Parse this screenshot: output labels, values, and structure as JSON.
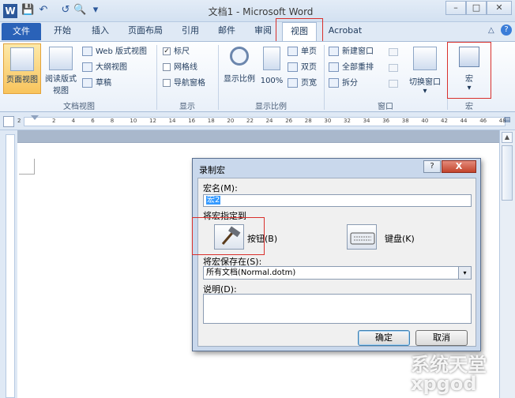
{
  "window": {
    "title": "文档1 - Microsoft Word",
    "minimize": "–",
    "restore": "□",
    "close": "✕"
  },
  "quick_access": {
    "save": "💾",
    "undo": "↶",
    "redo": "↺",
    "print_preview": "🔍",
    "customize": "▾"
  },
  "tabs": [
    "文件",
    "开始",
    "插入",
    "页面布局",
    "引用",
    "邮件",
    "审阅",
    "视图",
    "Acrobat"
  ],
  "active_tab": "视图",
  "ribbon": {
    "doc_views": {
      "print_layout": "页面视图",
      "reading_1": "阅读版式",
      "reading_2": "视图",
      "web": "Web 版式视图",
      "outline": "大纲视图",
      "draft": "草稿",
      "group": "文档视图"
    },
    "show": {
      "ruler": "标尺",
      "ruler_checked": "✓",
      "gridlines": "网格线",
      "nav_pane": "导航窗格",
      "group": "显示"
    },
    "zoom": {
      "zoom": "显示比例",
      "hundred": "100%",
      "one_page": "单页",
      "two_pages": "双页",
      "page_width": "页宽",
      "group": "显示比例"
    },
    "window": {
      "new_window": "新建窗口",
      "arrange_all": "全部重排",
      "split": "拆分",
      "switch_windows": "切换窗口",
      "group": "窗口",
      "switch_arrow": "▾"
    },
    "macros": {
      "macros": "宏",
      "arrow": "▾",
      "group": "宏"
    }
  },
  "ruler_ticks": [
    "2",
    "2",
    "4",
    "6",
    "8",
    "10",
    "12",
    "14",
    "16",
    "18",
    "20",
    "22",
    "24",
    "26",
    "28",
    "30",
    "32",
    "34",
    "36",
    "38",
    "40",
    "42",
    "44",
    "46",
    "48"
  ],
  "dialog": {
    "title": "录制宏",
    "help": "?",
    "close": "X",
    "macro_name_label": "宏名(M):",
    "macro_name_value": "宏2",
    "assign_label": "将宏指定到",
    "button_label": "按钮(B)",
    "keyboard_label": "键盘(K)",
    "store_label": "将宏保存在(S):",
    "store_value": "所有文档(Normal.dotm)",
    "store_arrow": "▾",
    "description_label": "说明(D):",
    "ok": "确定",
    "cancel": "取消"
  },
  "watermark": {
    "line1": "系统天堂",
    "line2": "xpgod"
  },
  "colors": {
    "accent": "#2a62b8",
    "highlight": "#d9302c"
  }
}
